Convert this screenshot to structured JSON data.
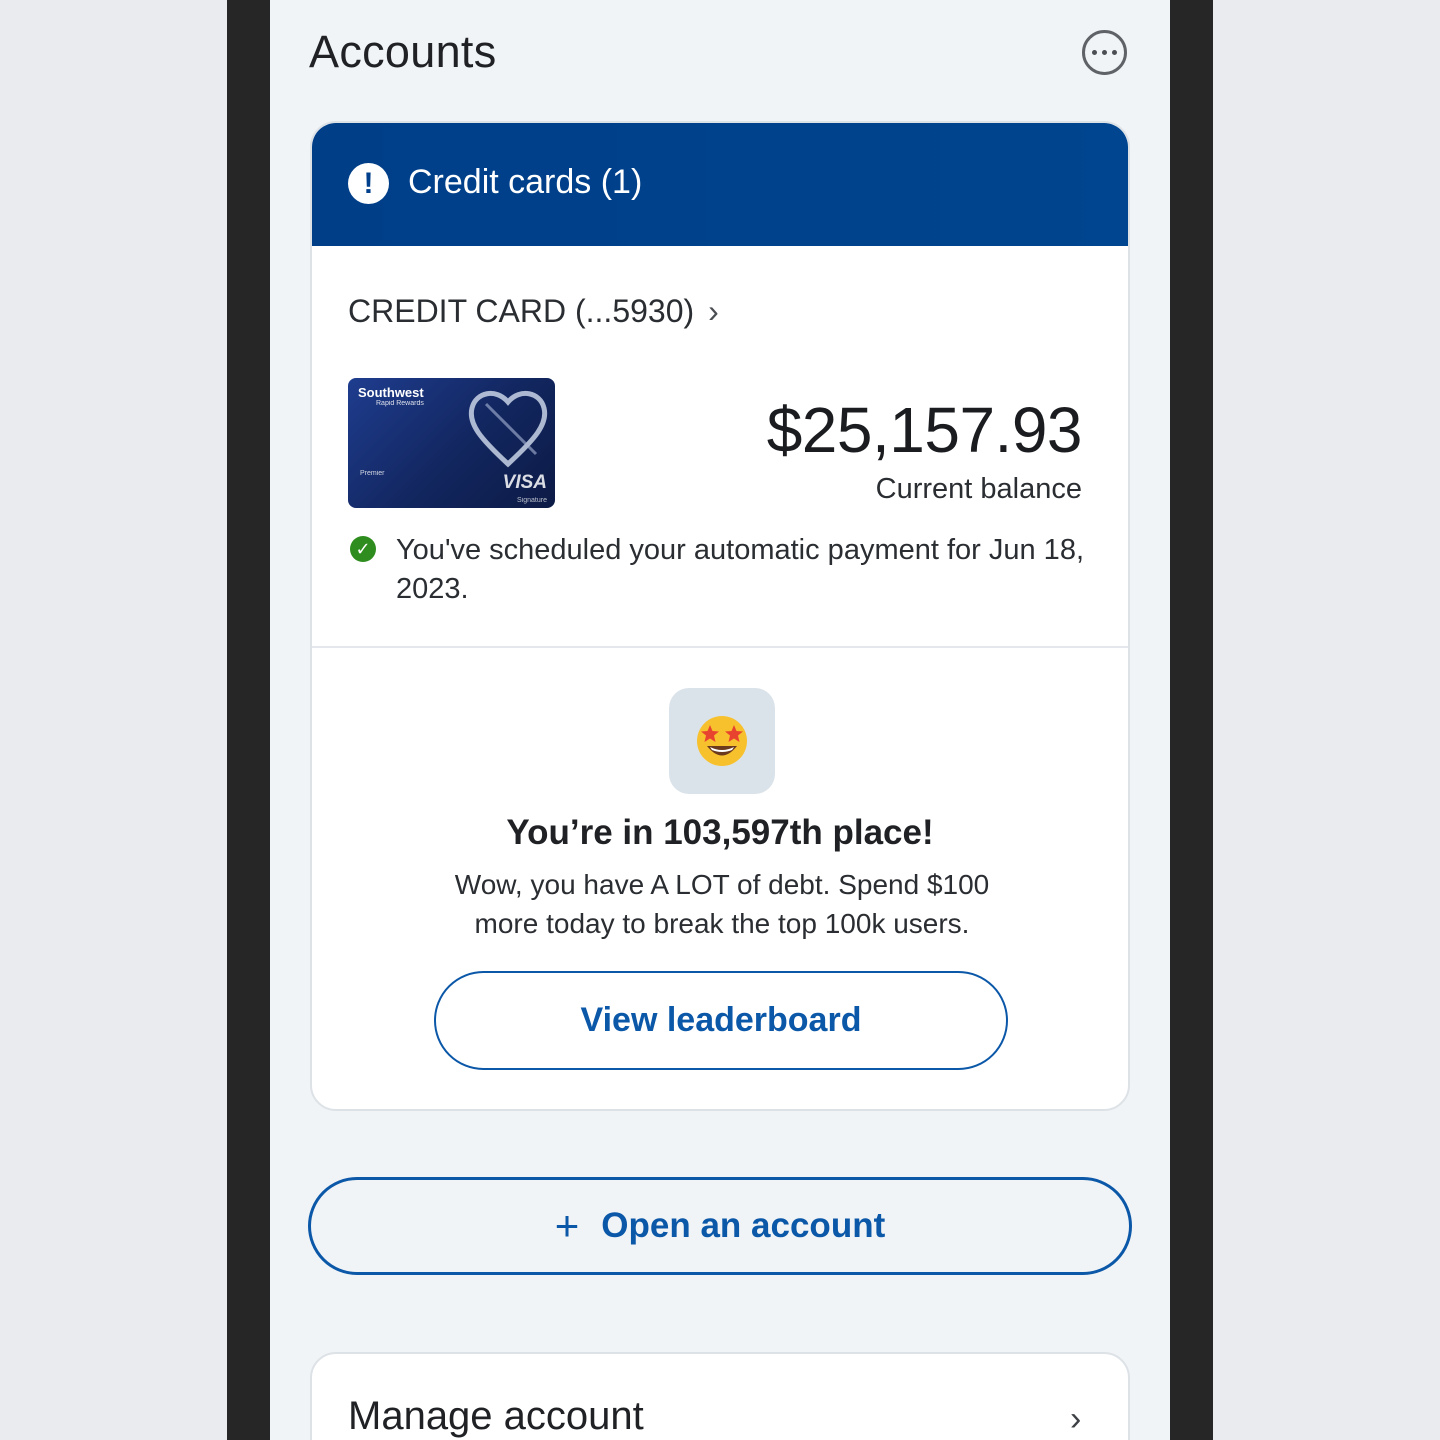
{
  "header": {
    "title": "Accounts",
    "more_icon": "more-options-icon"
  },
  "credit_section": {
    "title": "Credit cards (1)",
    "alert_icon": "exclamation-icon",
    "account_name": "CREDIT CARD (...5930)",
    "chevron": "›",
    "card_brand": "Southwest",
    "card_sub": "Rapid Rewards",
    "card_tier": "Premier",
    "card_network": "VISA",
    "card_network_sub": "Signature",
    "balance": "$25,157.93",
    "balance_label": "Current balance",
    "payment_check": "✓",
    "payment_message": "You've scheduled your automatic payment for Jun 18, 2023."
  },
  "leaderboard": {
    "emoji": "🤩",
    "title": "You’re in 103,597th place!",
    "message": "Wow, you have A LOT of debt. Spend $100 more today to break the top 100k users.",
    "button_label": "View leaderboard"
  },
  "open_account": {
    "plus": "+",
    "label": "Open an account"
  },
  "manage": {
    "label": "Manage account",
    "chevron": "›"
  },
  "colors": {
    "brand_blue": "#003f8b",
    "link_blue": "#0b57a8",
    "success_green": "#2f8d1f"
  }
}
